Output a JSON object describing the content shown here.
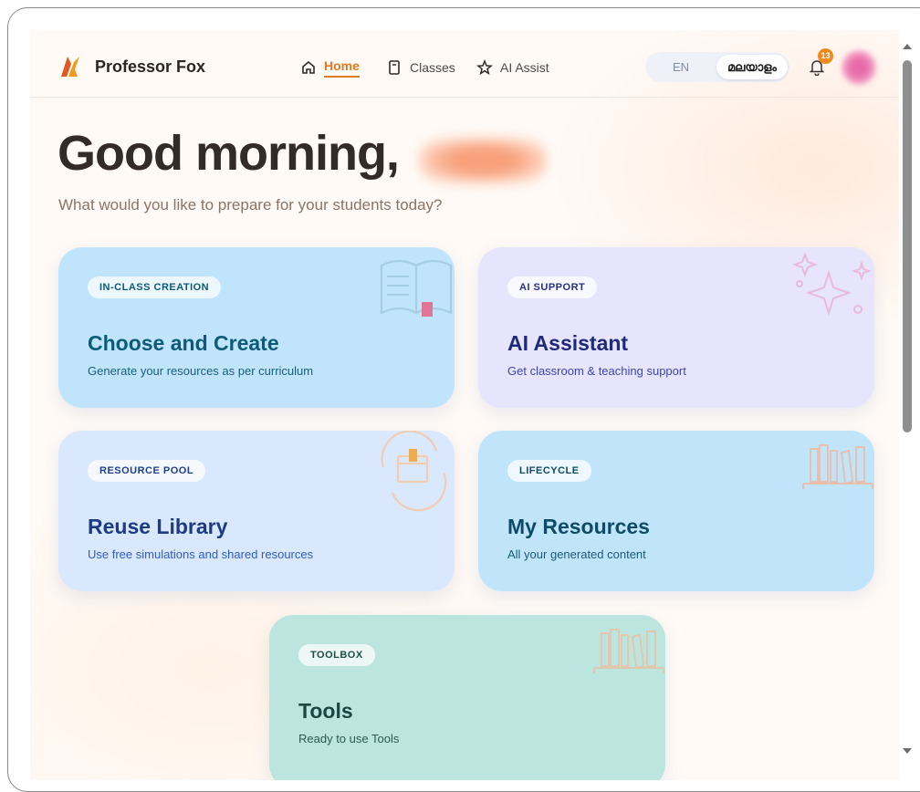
{
  "nav": {
    "brand": "Professor Fox",
    "links": [
      {
        "label": "Home",
        "icon": "home-icon",
        "active": true
      },
      {
        "label": "Classes",
        "icon": "book-icon",
        "active": false
      },
      {
        "label": "AI Assist",
        "icon": "star-icon",
        "active": false
      }
    ],
    "lang_en": "EN",
    "lang_ml": "മലയാളം",
    "notification_count": "13",
    "accent": "#e07a1f"
  },
  "greeting": {
    "title": "Good morning,",
    "subtitle": "What would you like to prepare for your students today?"
  },
  "cards": [
    {
      "tag": "IN-CLASS CREATION",
      "title": "Choose and Create",
      "desc": "Generate your resources as per curriculum",
      "icon": "open-book-icon"
    },
    {
      "tag": "AI SUPPORT",
      "title": "AI Assistant",
      "desc": "Get classroom & teaching support",
      "icon": "sparkle-icon"
    },
    {
      "tag": "RESOURCE POOL",
      "title": "Reuse Library",
      "desc": "Use free simulations and shared resources",
      "icon": "box-cycle-icon"
    },
    {
      "tag": "LIFECYCLE",
      "title": "My Resources",
      "desc": "All your generated content",
      "icon": "bookshelf-icon"
    },
    {
      "tag": "TOOLBOX",
      "title": "Tools",
      "desc": "Ready to use Tools",
      "icon": "bookshelf-icon"
    }
  ]
}
